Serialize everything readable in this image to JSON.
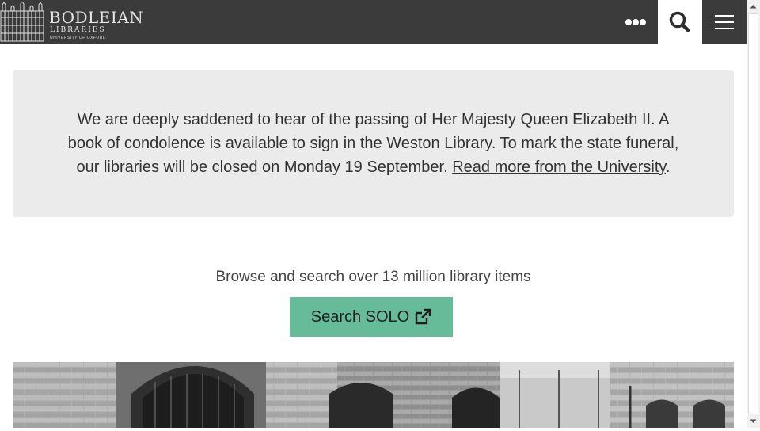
{
  "header": {
    "logo_title": "BODLEIAN",
    "logo_subtitle": "LIBRARIES",
    "logo_tagline": "UNIVERSITY OF OXFORD",
    "icons": {
      "logo": "bodleian-building-icon",
      "more": "ellipsis-icon",
      "search": "search-icon",
      "menu": "hamburger-menu-icon"
    },
    "colors": {
      "background": "#3b3b3b",
      "search_active": "#ffffff"
    }
  },
  "notice": {
    "text": "We are deeply saddened to hear of the passing of Her Majesty Queen Elizabeth II. A book of condolence is available to sign in the Weston Library. To mark the state funeral, our libraries will be closed on Monday 19 September. ",
    "link_label": "Read more from the University",
    "trailing": ".",
    "background": "#ebebeb"
  },
  "browse": {
    "text": "Browse and search over 13 million library items",
    "button_label": "Search SOLO",
    "button_icon": "external-link-icon",
    "button_color": "#66bb99"
  }
}
